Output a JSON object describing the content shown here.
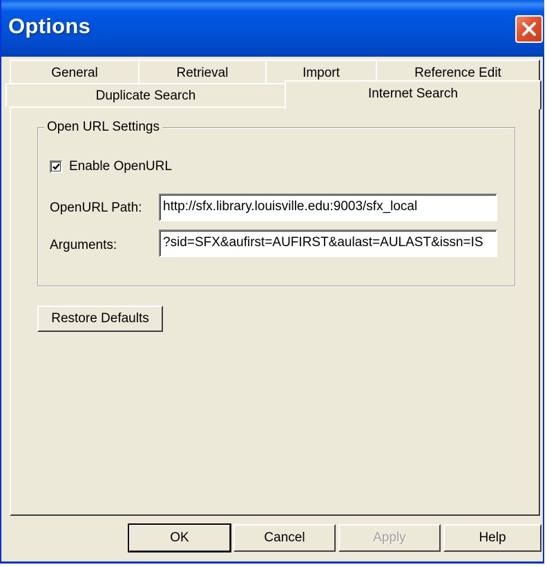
{
  "window": {
    "title": "Options",
    "close_icon": "close-icon"
  },
  "tabs": {
    "row1": [
      "General",
      "Retrieval",
      "Import",
      "Reference Edit"
    ],
    "row2": [
      "Duplicate Search",
      "Internet Search"
    ],
    "active": "Internet Search"
  },
  "open_url": {
    "group_label": "Open URL Settings",
    "enable_label": "Enable OpenURL",
    "enabled": true,
    "path_label": "OpenURL Path:",
    "path_value": "http://sfx.library.louisville.edu:9003/sfx_local",
    "args_label": "Arguments:",
    "args_value": "?sid=SFX&aufirst=AUFIRST&aulast=AULAST&issn=IS"
  },
  "restore_button": "Restore Defaults",
  "footer": {
    "ok": "OK",
    "cancel": "Cancel",
    "apply": "Apply",
    "apply_enabled": false,
    "help": "Help"
  },
  "colors": {
    "title_bar": "#0054e3",
    "close_button": "#e0502c",
    "dialog_face": "#ece9d8"
  }
}
